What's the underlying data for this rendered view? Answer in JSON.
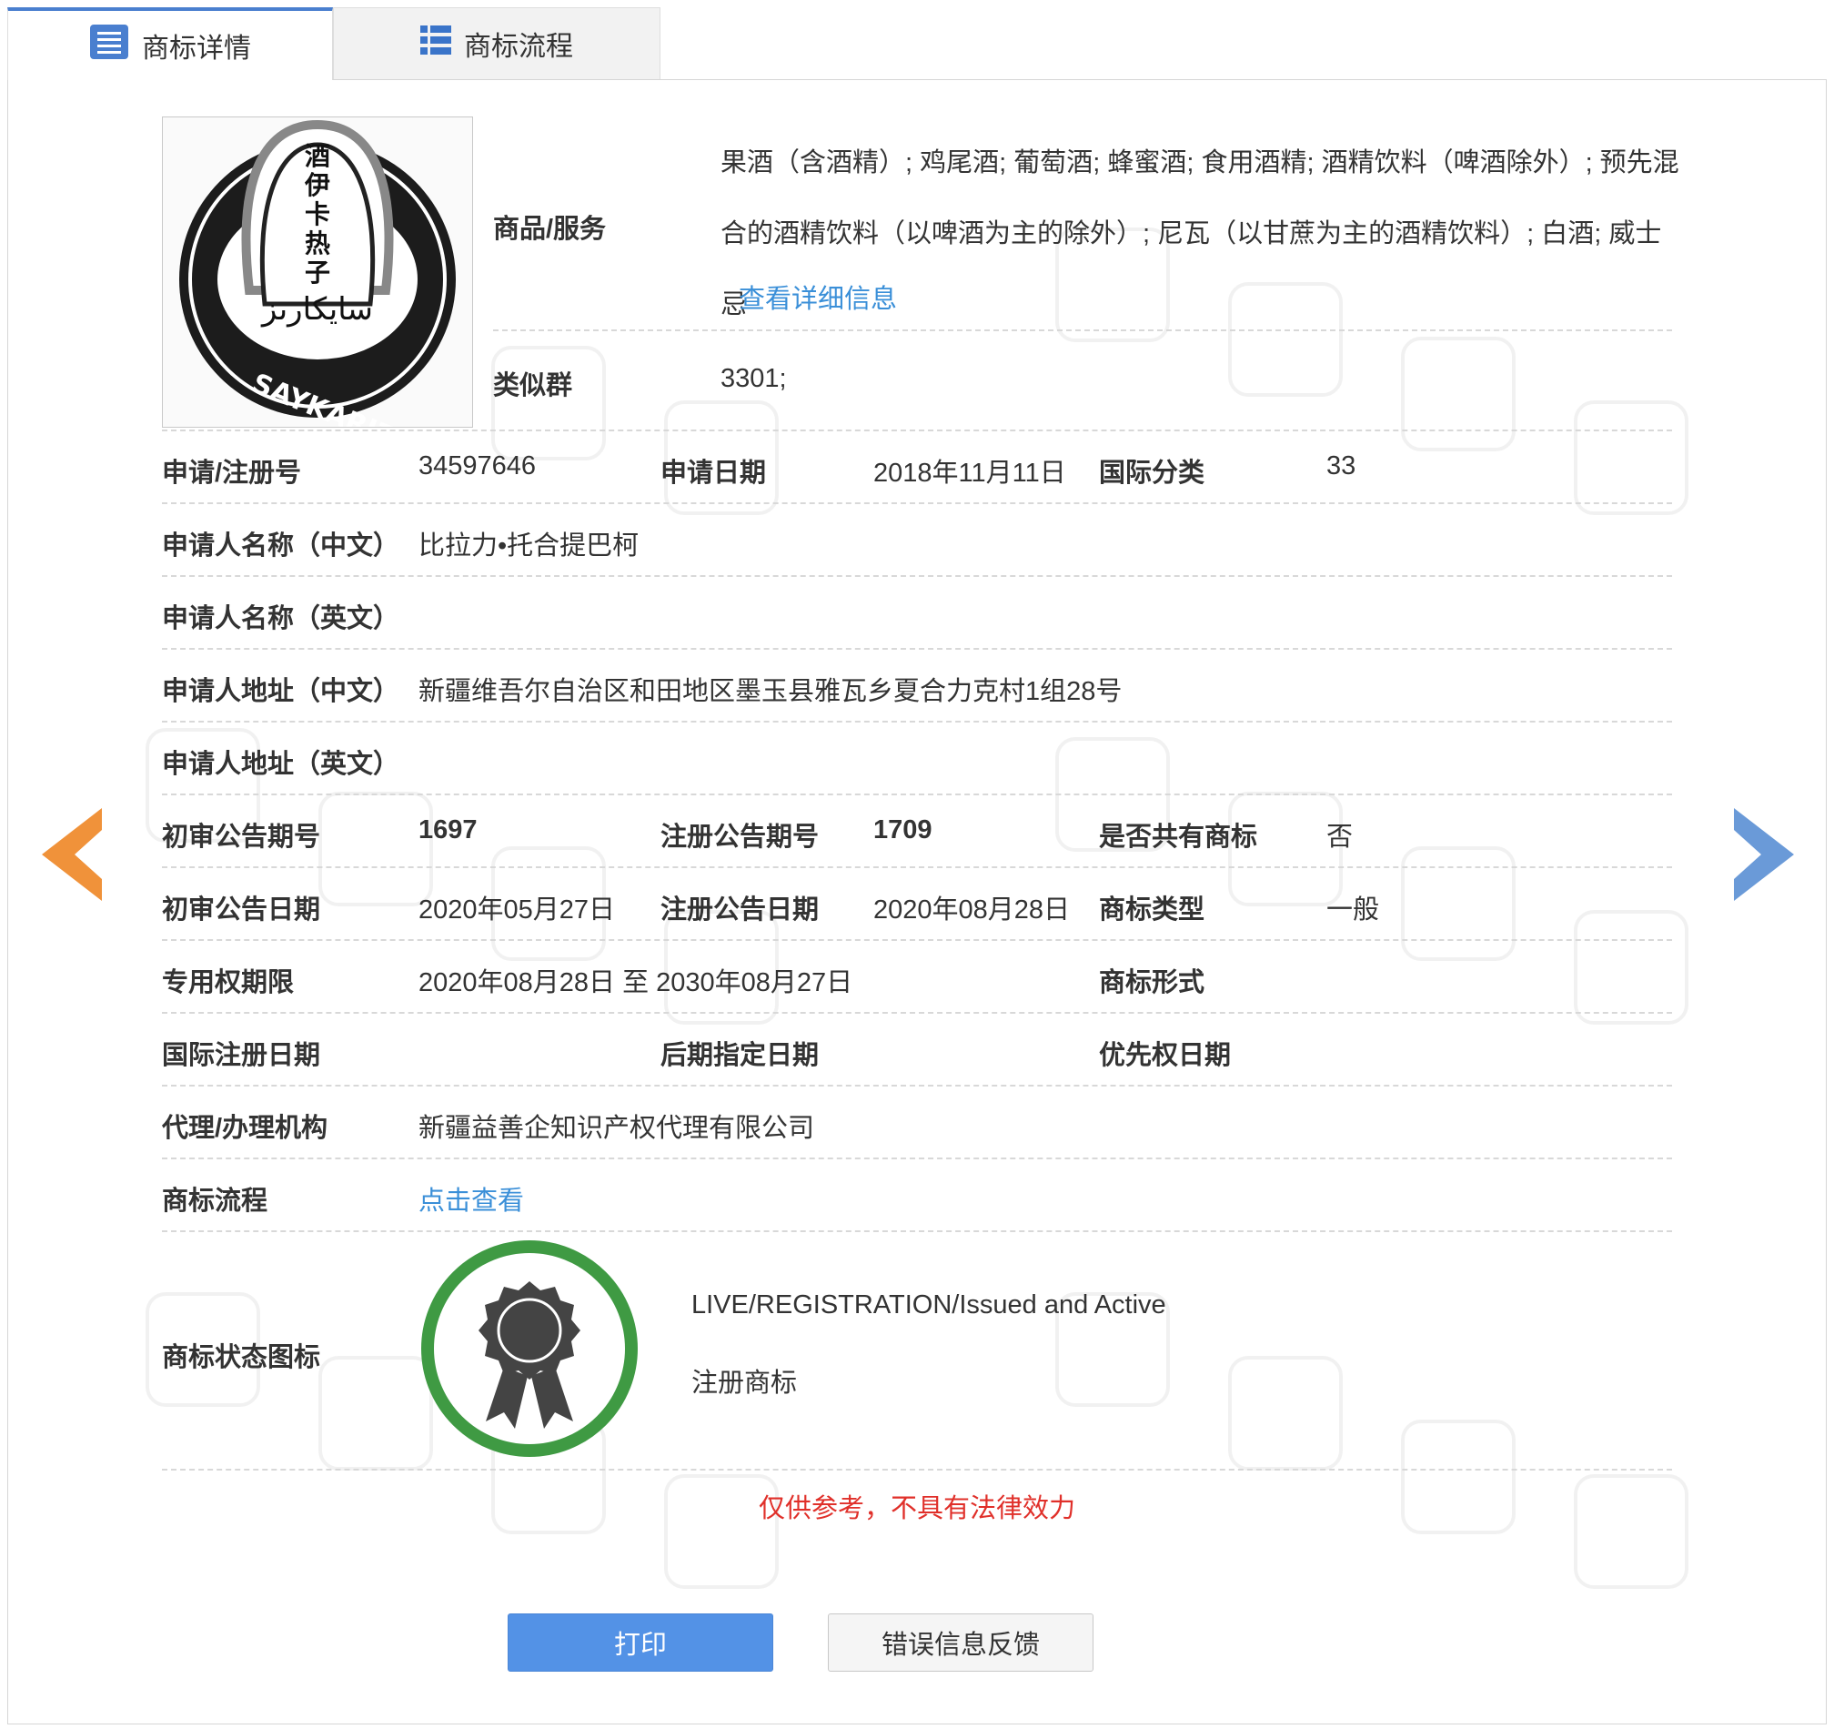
{
  "tabs": [
    {
      "label": "商标详情",
      "icon": "list-icon"
    },
    {
      "label": "商标流程",
      "icon": "grid-list-icon"
    }
  ],
  "trademark_image": {
    "vertical_text": [
      "酒",
      "伊",
      "卡",
      "热",
      "子"
    ],
    "uyghur_text": "سايكارىز",
    "latin_text": "SAYKARIZ"
  },
  "goods": {
    "label": "商品/服务",
    "value": "果酒（含酒精）; 鸡尾酒; 葡萄酒; 蜂蜜酒; 食用酒精; 酒精饮料（啤酒除外）; 预先混合的酒精饮料（以啤酒为主的除外）; 尼瓦（以甘蔗为主的酒精饮料）; 白酒; 威士忌",
    "detail_link": "查看详细信息"
  },
  "similar_group": {
    "label": "类似群",
    "value": "3301;"
  },
  "fields": {
    "reg_no": {
      "label": "申请/注册号",
      "value": "34597646"
    },
    "apply_date": {
      "label": "申请日期",
      "value": "2018年11月11日"
    },
    "intl_class": {
      "label": "国际分类",
      "value": "33"
    },
    "applicant_cn": {
      "label": "申请人名称（中文）",
      "value": "比拉力•托合提巴柯"
    },
    "applicant_en": {
      "label": "申请人名称（英文）",
      "value": ""
    },
    "address_cn": {
      "label": "申请人地址（中文）",
      "value": "新疆维吾尔自治区和田地区墨玉县雅瓦乡夏合力克村1组28号"
    },
    "address_en": {
      "label": "申请人地址（英文）",
      "value": ""
    },
    "prelim_issue": {
      "label": "初审公告期号",
      "value": "1697"
    },
    "reg_issue": {
      "label": "注册公告期号",
      "value": "1709"
    },
    "shared": {
      "label": "是否共有商标",
      "value": "否"
    },
    "prelim_date": {
      "label": "初审公告日期",
      "value": "2020年05月27日"
    },
    "reg_date": {
      "label": "注册公告日期",
      "value": "2020年08月28日"
    },
    "tm_type": {
      "label": "商标类型",
      "value": "一般"
    },
    "term": {
      "label": "专用权期限",
      "value": "2020年08月28日 至 2030年08月27日"
    },
    "tm_form": {
      "label": "商标形式",
      "value": ""
    },
    "intl_reg_date": {
      "label": "国际注册日期",
      "value": ""
    },
    "later_date": {
      "label": "后期指定日期",
      "value": ""
    },
    "priority_date": {
      "label": "优先权日期",
      "value": ""
    },
    "agent": {
      "label": "代理/办理机构",
      "value": "新疆益善企知识产权代理有限公司"
    },
    "process": {
      "label": "商标流程",
      "value": "点击查看"
    }
  },
  "status": {
    "label": "商标状态图标",
    "icon": "award-ribbon-icon",
    "line1": "LIVE/REGISTRATION/Issued and Active",
    "line2": "注册商标"
  },
  "disclaimer": "仅供参考，不具有法律效力",
  "buttons": {
    "print": "打印",
    "feedback": "错误信息反馈"
  },
  "colors": {
    "link": "#3a8fd8",
    "print_button": "#5392e6",
    "disclaimer": "#e0302a",
    "left_arrow": "#f0923a",
    "right_arrow": "#6a9ad8",
    "status_ring": "#3f9a43"
  }
}
